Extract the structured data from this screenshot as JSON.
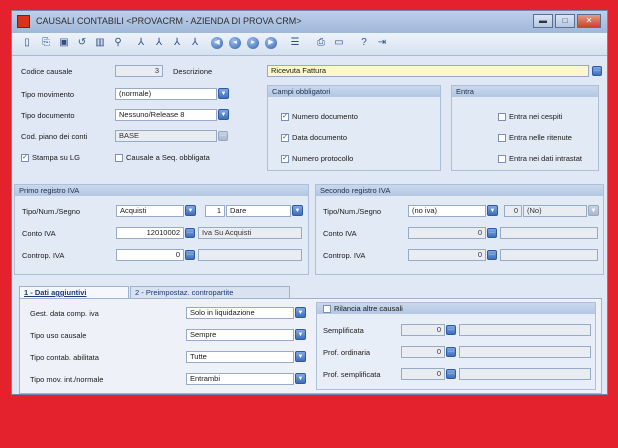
{
  "window": {
    "title": "CAUSALI CONTABILI <PROVACRM - AZIENDA DI PROVA CRM>",
    "min_glyph": "▬",
    "max_glyph": "□",
    "close_glyph": "✕"
  },
  "toolbar": {
    "icons": [
      "new-document-icon",
      "copy-icon",
      "save-icon",
      "undo-icon",
      "delete-icon",
      "search-icon",
      "filter-icon",
      "filter-add-icon",
      "filter-next-icon",
      "filter-clear-icon",
      "first-record-icon",
      "previous-record-icon",
      "next-record-icon",
      "last-record-icon",
      "list-view-icon",
      "print-icon",
      "preview-icon",
      "help-icon",
      "exit-icon"
    ],
    "glyphs": [
      "▯",
      "⎘",
      "▣",
      "↺",
      "▥",
      "⚲",
      "⅄",
      "⅄",
      "⅄",
      "⅄",
      "◀",
      "◂",
      "▸",
      "▶",
      "☰",
      "⎙",
      "▭",
      "?",
      "⇥"
    ]
  },
  "form": {
    "codice_label": "Codice causale",
    "codice_value": "3",
    "descrizione_label": "Descrizione",
    "descrizione_value": "Ricevuta Fattura",
    "tipo_movimento_label": "Tipo movimento",
    "tipo_movimento_value": "(normale)",
    "tipo_documento_label": "Tipo documento",
    "tipo_documento_value": "Nessuno/Release 8",
    "cod_piano_label": "Cod. piano dei conti",
    "cod_piano_value": "BASE",
    "stampa_lg_label": "Stampa su LG",
    "stampa_lg_checked": true,
    "causale_seq_label": "Causale a Seq. obbligata",
    "causale_seq_checked": false
  },
  "campi_obbligatori": {
    "title": "Campi obbligatori",
    "items": [
      {
        "label": "Numero documento",
        "checked": true
      },
      {
        "label": "Data documento",
        "checked": true
      },
      {
        "label": "Numero protocollo",
        "checked": true
      }
    ]
  },
  "entra": {
    "title": "Entra",
    "items": [
      {
        "label": "Entra nei cespiti",
        "checked": false
      },
      {
        "label": "Entra nelle ritenute",
        "checked": false
      },
      {
        "label": "Entra nei dati intrastat",
        "checked": false
      }
    ]
  },
  "primo_registro": {
    "title": "Primo registro IVA",
    "tipo_label": "Tipo/Num./Segno",
    "tipo_value": "Acquisti",
    "num_value": "1",
    "segno_value": "Dare",
    "conto_label": "Conto IVA",
    "conto_value": "12010002",
    "conto_desc": "Iva Su Acquisti",
    "controp_label": "Controp. IVA",
    "controp_value": "0"
  },
  "secondo_registro": {
    "title": "Secondo registro IVA",
    "tipo_label": "Tipo/Num./Segno",
    "tipo_value": "(no iva)",
    "num_value": "0",
    "segno_value": "(No)",
    "conto_label": "Conto IVA",
    "conto_value": "0",
    "controp_label": "Controp. IVA",
    "controp_value": "0"
  },
  "tabs": [
    {
      "label": "1 - Dati aggiuntivi",
      "active": true
    },
    {
      "label": "2 - Preimpostaz. contropartite",
      "active": false
    }
  ],
  "dati_aggiuntivi": {
    "rows": [
      {
        "label": "Gest. data comp. iva",
        "value": "Solo in liquidazione"
      },
      {
        "label": "Tipo uso causale",
        "value": "Sempre"
      },
      {
        "label": "Tipo contab. abilitata",
        "value": "Tutte"
      },
      {
        "label": "Tipo mov. int./normale",
        "value": "Entrambi"
      }
    ],
    "rilancia_label": "Rilancia altre causali",
    "rilancia_checked": false,
    "right_rows": [
      {
        "label": "Semplificata",
        "value": "0"
      },
      {
        "label": "Prof. ordinaria",
        "value": "0"
      },
      {
        "label": "Prof. semplificata",
        "value": "0"
      }
    ]
  },
  "glyphs": {
    "dropdown": "▼",
    "ellipsis": "···",
    "check": "✓"
  }
}
